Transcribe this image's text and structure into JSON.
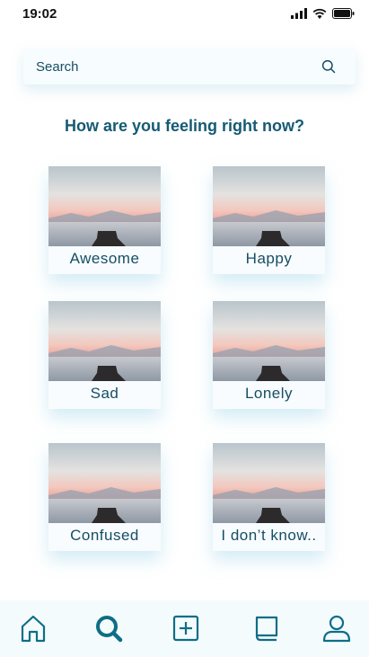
{
  "status_bar": {
    "time": "19:02"
  },
  "search": {
    "placeholder": "Search"
  },
  "question": "How are you feeling right now?",
  "moods": [
    "Awesome",
    "Happy",
    "Sad",
    "Lonely",
    "Confused",
    "I don’t know.."
  ],
  "nav": {
    "items": [
      "home-icon",
      "search-icon",
      "add-square-icon",
      "journal-icon",
      "profile-icon"
    ],
    "active": "search-icon"
  },
  "colors": {
    "accent": "#0e6e86",
    "text": "#164e63",
    "nav_bg": "#f4fbfd"
  }
}
